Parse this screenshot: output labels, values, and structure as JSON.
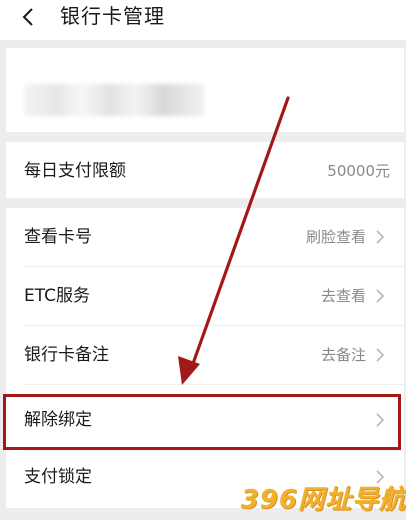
{
  "header": {
    "title": "银行卡管理"
  },
  "limit": {
    "label": "每日支付限额",
    "value": "50000元"
  },
  "items": [
    {
      "label": "查看卡号",
      "value": "刷脸查看"
    },
    {
      "label": "ETC服务",
      "value": "去查看"
    },
    {
      "label": "银行卡备注",
      "value": "去备注"
    },
    {
      "label": "解除绑定",
      "value": ""
    },
    {
      "label": "支付锁定",
      "value": ""
    }
  ],
  "icons": {
    "back": "back-arrow-icon",
    "chevron": "chevron-right-icon"
  },
  "annotation": {
    "color": "#a31818",
    "highlighted_item": "解除绑定"
  },
  "watermark": {
    "text": "396网址导航"
  },
  "colors": {
    "background": "#ededed",
    "card": "#ffffff",
    "secondary_text": "#8a8a8a",
    "watermark": "#f2b12b"
  }
}
